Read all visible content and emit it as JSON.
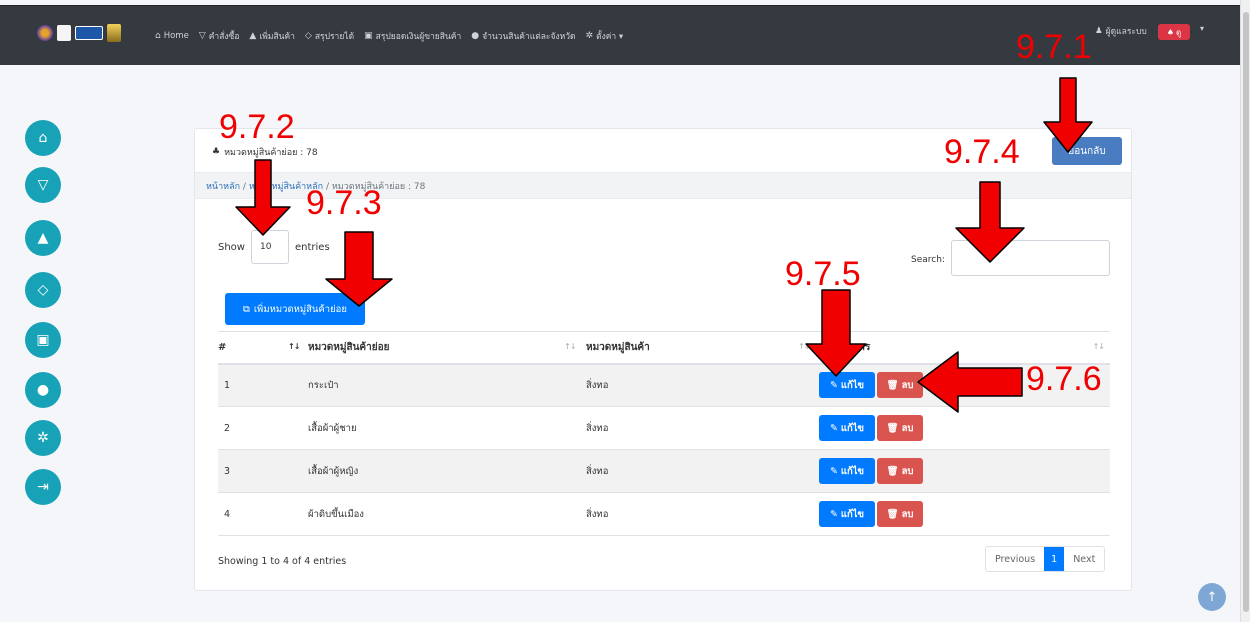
{
  "nav": {
    "items": [
      {
        "icon": "home-icon",
        "glyph": "⌂",
        "label": "Home"
      },
      {
        "icon": "cart-icon",
        "glyph": "▽",
        "label": "คำสั่งซื้อ"
      },
      {
        "icon": "bag-icon",
        "glyph": "▲",
        "label": "เพิ่มสินค้า"
      },
      {
        "icon": "gem-icon",
        "glyph": "◇",
        "label": "สรุปรายได้"
      },
      {
        "icon": "money-icon",
        "glyph": "▣",
        "label": "สรุปยอดเงินผู้ขายสินค้า"
      },
      {
        "icon": "pin-icon",
        "glyph": "●",
        "label": "จำนวนสินค้าแต่ละจังหวัด"
      },
      {
        "icon": "gear-icon",
        "glyph": "✲",
        "label": "ตั้งค่า ▾"
      }
    ],
    "user_label": "ผู้ดูแลระบบ",
    "bell_label": "ดู"
  },
  "sidebar": [
    {
      "icon": "home-icon",
      "glyph": "⌂"
    },
    {
      "icon": "cart-icon",
      "glyph": "▽"
    },
    {
      "icon": "bag-icon",
      "glyph": "▲"
    },
    {
      "icon": "gem-icon",
      "glyph": "◇"
    },
    {
      "icon": "money-icon",
      "glyph": "▣"
    },
    {
      "icon": "pin-icon",
      "glyph": "●"
    },
    {
      "icon": "gear-icon",
      "glyph": "✲"
    },
    {
      "icon": "logout-icon",
      "glyph": "⇥"
    }
  ],
  "card": {
    "title": "หมวดหมู่สินค้าย่อย : 78",
    "back_label": "ย้อนกลับ",
    "breadcrumb": {
      "home": "หน้าหลัก",
      "parent": "หมวดหมู่สินค้าหลัก",
      "current": "หมวดหมู่สินค้าย่อย : 78"
    },
    "show_label": "Show",
    "show_value": "10",
    "entries_label": "entries",
    "search_label": "Search:",
    "add_label": "เพิ่มหมวดหมู่สินค้าย่อย",
    "table": {
      "headers": [
        "#",
        "หมวดหมู่สินค้าย่อย",
        "หมวดหมู่สินค้า",
        "จัดการ"
      ],
      "rows": [
        {
          "no": "1",
          "sub": "กระเป๋า",
          "cat": "สิ่งทอ"
        },
        {
          "no": "2",
          "sub": "เสื้อผ้าผู้ชาย",
          "cat": "สิ่งทอ"
        },
        {
          "no": "3",
          "sub": "เสื้อผ้าผู้หญิง",
          "cat": "สิ่งทอ"
        },
        {
          "no": "4",
          "sub": "ผ้าดิบขึ้นเมือง",
          "cat": "สิ่งทอ"
        }
      ],
      "edit_label": "แก้ไข",
      "delete_label": "ลบ"
    },
    "info": "Showing 1 to 4 of 4 entries",
    "pager": {
      "prev": "Previous",
      "page": "1",
      "next": "Next"
    }
  },
  "annotations": {
    "a1": "9.7.1",
    "a2": "9.7.2",
    "a3": "9.7.3",
    "a4": "9.7.4",
    "a5": "9.7.5",
    "a6": "9.7.6"
  },
  "colors": {
    "navbar": "#343a40",
    "sidebar_circle": "#17a2b8",
    "primary": "#007bff",
    "danger": "#d9534f",
    "annotation": "#f00000"
  }
}
